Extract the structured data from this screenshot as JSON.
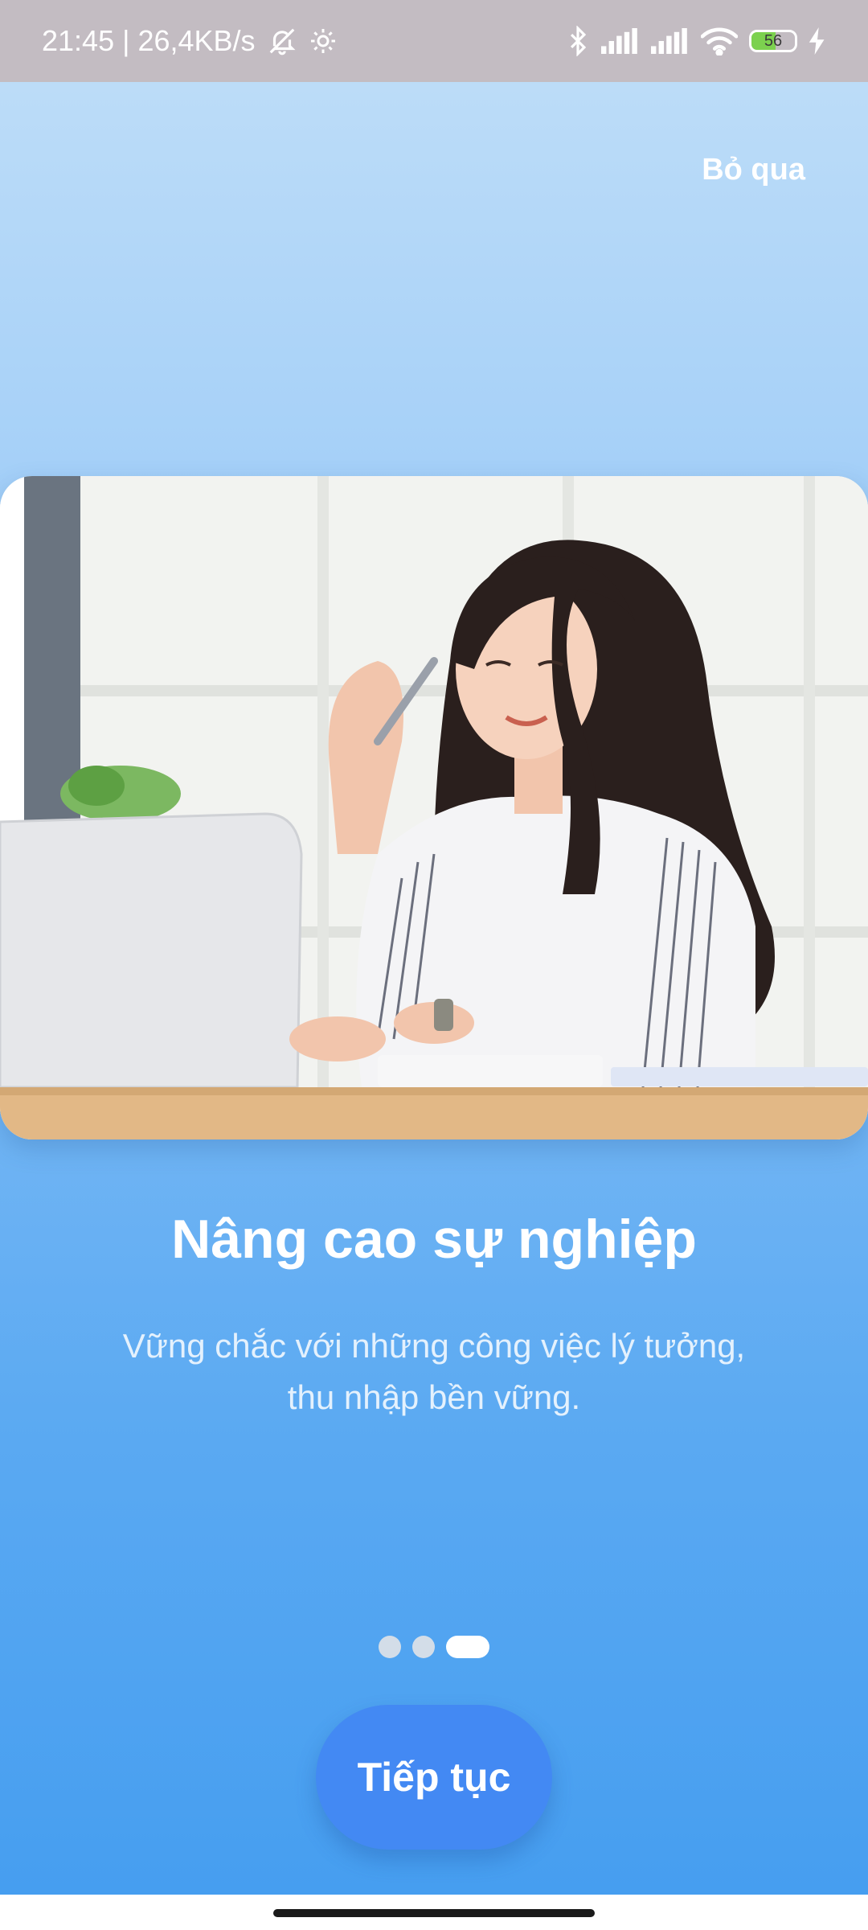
{
  "status_bar": {
    "time_speed": "21:45 | 26,4KB/s",
    "battery": "56",
    "battery_level": 0.56,
    "icons": [
      "bell-off-icon",
      "settings-icon",
      "bluetooth-icon",
      "signal-icon",
      "signal-icon",
      "wifi-icon",
      "battery-icon",
      "charging-icon"
    ]
  },
  "onboarding": {
    "skip_label": "Bỏ qua",
    "title": "Nâng cao sự nghiệp",
    "subtitle_line1": "Vững chắc với những công việc lý tưởng,",
    "subtitle_line2": "thu nhập bền vững.",
    "page_index": 3,
    "page_count": 3,
    "continue_label": "Tiếp tục"
  },
  "colors": {
    "gradient_top": "#bcdcf8",
    "gradient_bottom": "#469ef0",
    "button": "#4389f3",
    "status_bar": "#c3bcc2"
  }
}
